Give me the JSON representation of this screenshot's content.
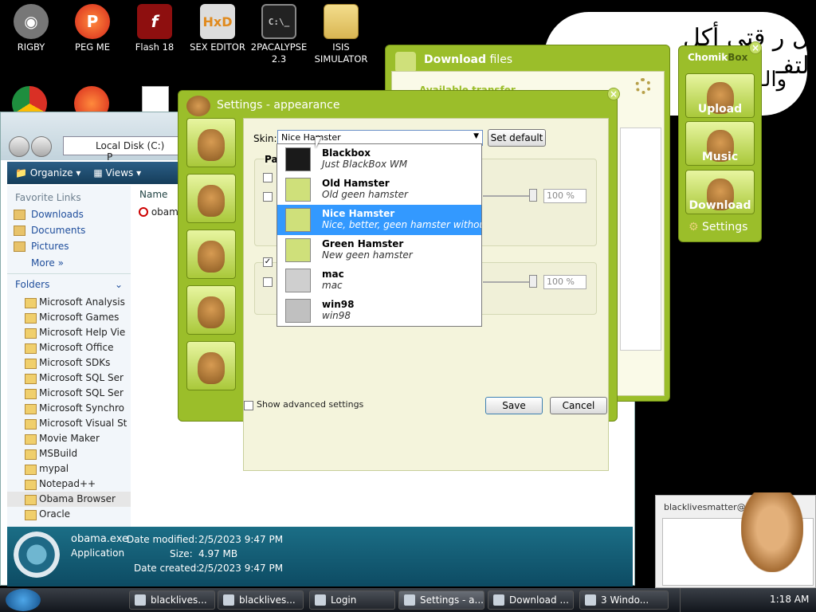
{
  "desktop": {
    "icons": [
      {
        "label": "RIGBY",
        "icon": "raccoon-icon"
      },
      {
        "label": "PEG ME",
        "icon": "peg-icon"
      },
      {
        "label": "Flash 18",
        "icon": "flash-icon"
      },
      {
        "label": "SEX EDITOR",
        "icon": "hxd-icon"
      },
      {
        "label": "2PACALYPSE 2.3",
        "icon": "terminal-icon"
      },
      {
        "label": "ISIS SIMULATOR",
        "icon": "folder-icon"
      }
    ],
    "arabic_text": "ال ر قتي أكل التفـ",
    "arabic_line2": "والـ ة"
  },
  "explorer": {
    "address": "Local Disk (C:)",
    "address_arrow": "P",
    "toolbar": {
      "organize": "Organize",
      "views": "Views"
    },
    "favorite_links_header": "Favorite Links",
    "favorite_links": [
      "Downloads",
      "Documents",
      "Pictures"
    ],
    "more": "More",
    "folders_header": "Folders",
    "column_name": "Name",
    "file_item": "obam",
    "folders": [
      "Microsoft Analysis",
      "Microsoft Games",
      "Microsoft Help Vie",
      "Microsoft Office",
      "Microsoft SDKs",
      "Microsoft SQL Ser",
      "Microsoft SQL Ser",
      "Microsoft Synchro",
      "Microsoft Visual St",
      "Movie Maker",
      "MSBuild",
      "mypal",
      "Notepad++",
      "Obama Browser",
      "Oracle"
    ],
    "details": {
      "filename": "obama.exe",
      "type": "Application",
      "modified_label": "Date modified:",
      "modified": "2/5/2023 9:47 PM",
      "size_label": "Size:",
      "size": "4.97 MB",
      "created_label": "Date created:",
      "created": "2/5/2023 9:47 PM"
    }
  },
  "download_window": {
    "title_bold": "Download",
    "title_rest": "files",
    "subtitle": "Available transfer"
  },
  "chomikbox": {
    "title_a": "Chomik",
    "title_b": "Box",
    "upload": "Upload",
    "music": "Music",
    "download": "Download",
    "settings": "Settings"
  },
  "settings_dialog": {
    "title": "Settings - appearance",
    "skin_label": "Skin:",
    "skin_value": "Nice Hamster",
    "set_default": "Set default",
    "panel_label": "Pa",
    "percent1": "100 %",
    "percent2": "100 %",
    "show_advanced": "Show advanced settings",
    "save": "Save",
    "cancel": "Cancel"
  },
  "skin_options": [
    {
      "name": "Blackbox",
      "desc": "Just BlackBox WM",
      "selected": false
    },
    {
      "name": "Old Hamster",
      "desc": "Old geen hamster",
      "selected": false
    },
    {
      "name": "Nice Hamster",
      "desc": "Nice, better, geen hamster without big",
      "selected": true
    },
    {
      "name": "Green Hamster",
      "desc": "New geen hamster",
      "selected": false
    },
    {
      "name": "mac",
      "desc": "mac",
      "selected": false
    },
    {
      "name": "win98",
      "desc": "win98",
      "selected": false
    }
  ],
  "chat_window": {
    "title": "blacklivesmatter@qq"
  },
  "taskbar": {
    "items": [
      "blacklives...",
      "blacklives...",
      "Login",
      "Settings - a...",
      "Download ...",
      "3 Windo..."
    ],
    "clock": "1:18 AM"
  }
}
